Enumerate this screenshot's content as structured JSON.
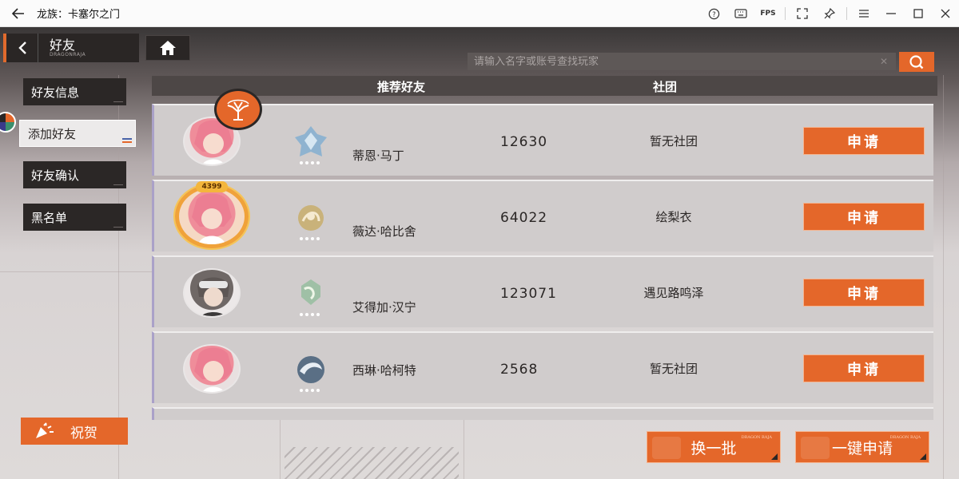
{
  "window": {
    "title": "龙族：卡塞尔之门",
    "fps_label": "FPS"
  },
  "header": {
    "title": "好友",
    "subtitle": "DRAGONRAJA"
  },
  "search": {
    "placeholder": "请输入名字或账号查找玩家",
    "value": ""
  },
  "menu": {
    "items": [
      {
        "label": "好友信息"
      },
      {
        "label": "添加好友"
      },
      {
        "label": "好友确认"
      },
      {
        "label": "黑名单"
      }
    ],
    "active": "添加好友"
  },
  "congrats_label": "祝贺",
  "table": {
    "col_recommend": "推荐好友",
    "col_club": "社团",
    "rows": [
      {
        "name": "蒂恩·马丁",
        "id": "12630",
        "club": "暂无社团",
        "apply": "申请"
      },
      {
        "name": "薇达·哈比舍",
        "id": "64022",
        "club": "绘梨衣",
        "apply": "申请"
      },
      {
        "name": "艾得加·汉宁",
        "id": "123071",
        "club": "遇见路鸣泽",
        "apply": "申请"
      },
      {
        "name": "西琳·哈柯特",
        "id": "2568",
        "club": "暂无社团",
        "apply": "申请"
      }
    ]
  },
  "avatar_badge_text": "4399",
  "buttons": {
    "refresh": "换一批",
    "apply_all": "一键申请",
    "deco_text": "DRAGON RAJA"
  },
  "colors": {
    "accent": "#e4672a",
    "panel_dark": "#2b2726",
    "row_bg": "#d0cccc"
  }
}
